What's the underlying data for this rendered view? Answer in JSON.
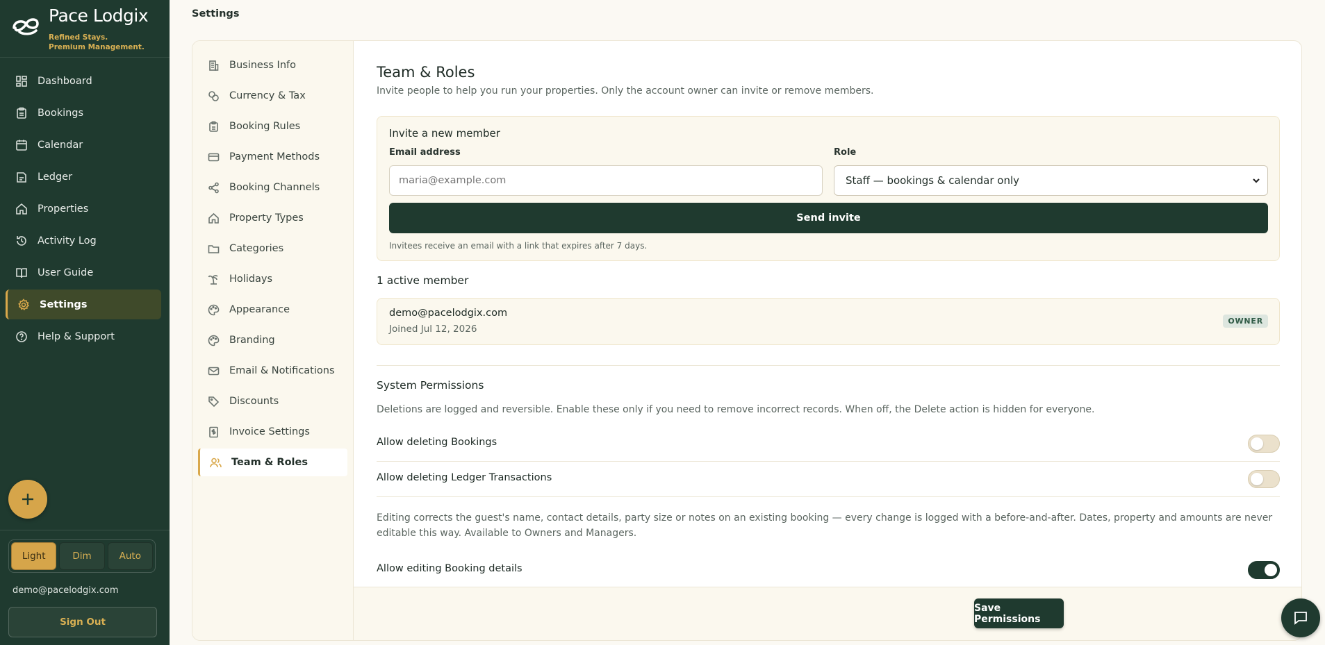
{
  "brand": {
    "name": "Pace Lodgix",
    "tagline_1": "Refined Stays.",
    "tagline_2": "Premium Management."
  },
  "sidebar": {
    "items": [
      {
        "label": "Dashboard",
        "icon": "dashboard-icon"
      },
      {
        "label": "Bookings",
        "icon": "clipboard-icon"
      },
      {
        "label": "Calendar",
        "icon": "calendar-icon"
      },
      {
        "label": "Ledger",
        "icon": "ledger-icon"
      },
      {
        "label": "Properties",
        "icon": "home-icon"
      },
      {
        "label": "Activity Log",
        "icon": "history-icon"
      },
      {
        "label": "User Guide",
        "icon": "book-icon"
      },
      {
        "label": "Settings",
        "icon": "gear-icon",
        "active": true
      },
      {
        "label": "Help & Support",
        "icon": "help-icon"
      }
    ],
    "theme": {
      "light": "Light",
      "dim": "Dim",
      "auto": "Auto",
      "selected": "Light"
    },
    "user_email": "demo@pacelodgix.com",
    "sign_out": "Sign Out"
  },
  "page": {
    "title": "Settings"
  },
  "settings_nav": [
    {
      "label": "Business Info",
      "icon": "building-icon"
    },
    {
      "label": "Currency & Tax",
      "icon": "coins-icon"
    },
    {
      "label": "Booking Rules",
      "icon": "clipboard-icon"
    },
    {
      "label": "Payment Methods",
      "icon": "credit-card-icon"
    },
    {
      "label": "Booking Channels",
      "icon": "share-icon"
    },
    {
      "label": "Property Types",
      "icon": "home-icon"
    },
    {
      "label": "Categories",
      "icon": "folder-icon"
    },
    {
      "label": "Holidays",
      "icon": "palm-tree-icon"
    },
    {
      "label": "Appearance",
      "icon": "palette-icon"
    },
    {
      "label": "Branding",
      "icon": "palette-icon"
    },
    {
      "label": "Email & Notifications",
      "icon": "mail-icon"
    },
    {
      "label": "Discounts",
      "icon": "tag-icon"
    },
    {
      "label": "Invoice Settings",
      "icon": "invoice-icon"
    },
    {
      "label": "Team & Roles",
      "icon": "users-icon",
      "active": true
    }
  ],
  "team": {
    "heading": "Team & Roles",
    "subheading": "Invite people to help you run your properties. Only the account owner can invite or remove members.",
    "invite": {
      "title": "Invite a new member",
      "email_label": "Email address",
      "email_placeholder": "maria@example.com",
      "email_value": "",
      "role_label": "Role",
      "role_value": "Staff — bookings & calendar only",
      "send_label": "Send invite",
      "note": "Invitees receive an email with a link that expires after 7 days."
    },
    "members_title": "1 active member",
    "members": [
      {
        "email": "demo@pacelodgix.com",
        "joined": "Joined Jul 12, 2026",
        "badge": "OWNER"
      }
    ]
  },
  "system_permissions": {
    "title": "System Permissions",
    "description": "Deletions are logged and reversible. Enable these only if you need to remove incorrect records. When off, the Delete action is hidden for everyone.",
    "delete_bookings": {
      "label": "Allow deleting Bookings",
      "enabled": false
    },
    "delete_ledger": {
      "label": "Allow deleting Ledger Transactions",
      "enabled": false
    },
    "edit_description": "Editing corrects the guest's name, contact details, party size or notes on an existing booking — every change is logged with a before-and-after. Dates, property and amounts are never editable this way. Available to Owners and Managers.",
    "edit_bookings": {
      "label": "Allow editing Booking details",
      "enabled": true
    }
  },
  "footer": {
    "save_label": "Save Permissions"
  },
  "colors": {
    "sidebar": "#1f3a2f",
    "accent": "#d6a54a",
    "background": "#fbf9f3"
  }
}
